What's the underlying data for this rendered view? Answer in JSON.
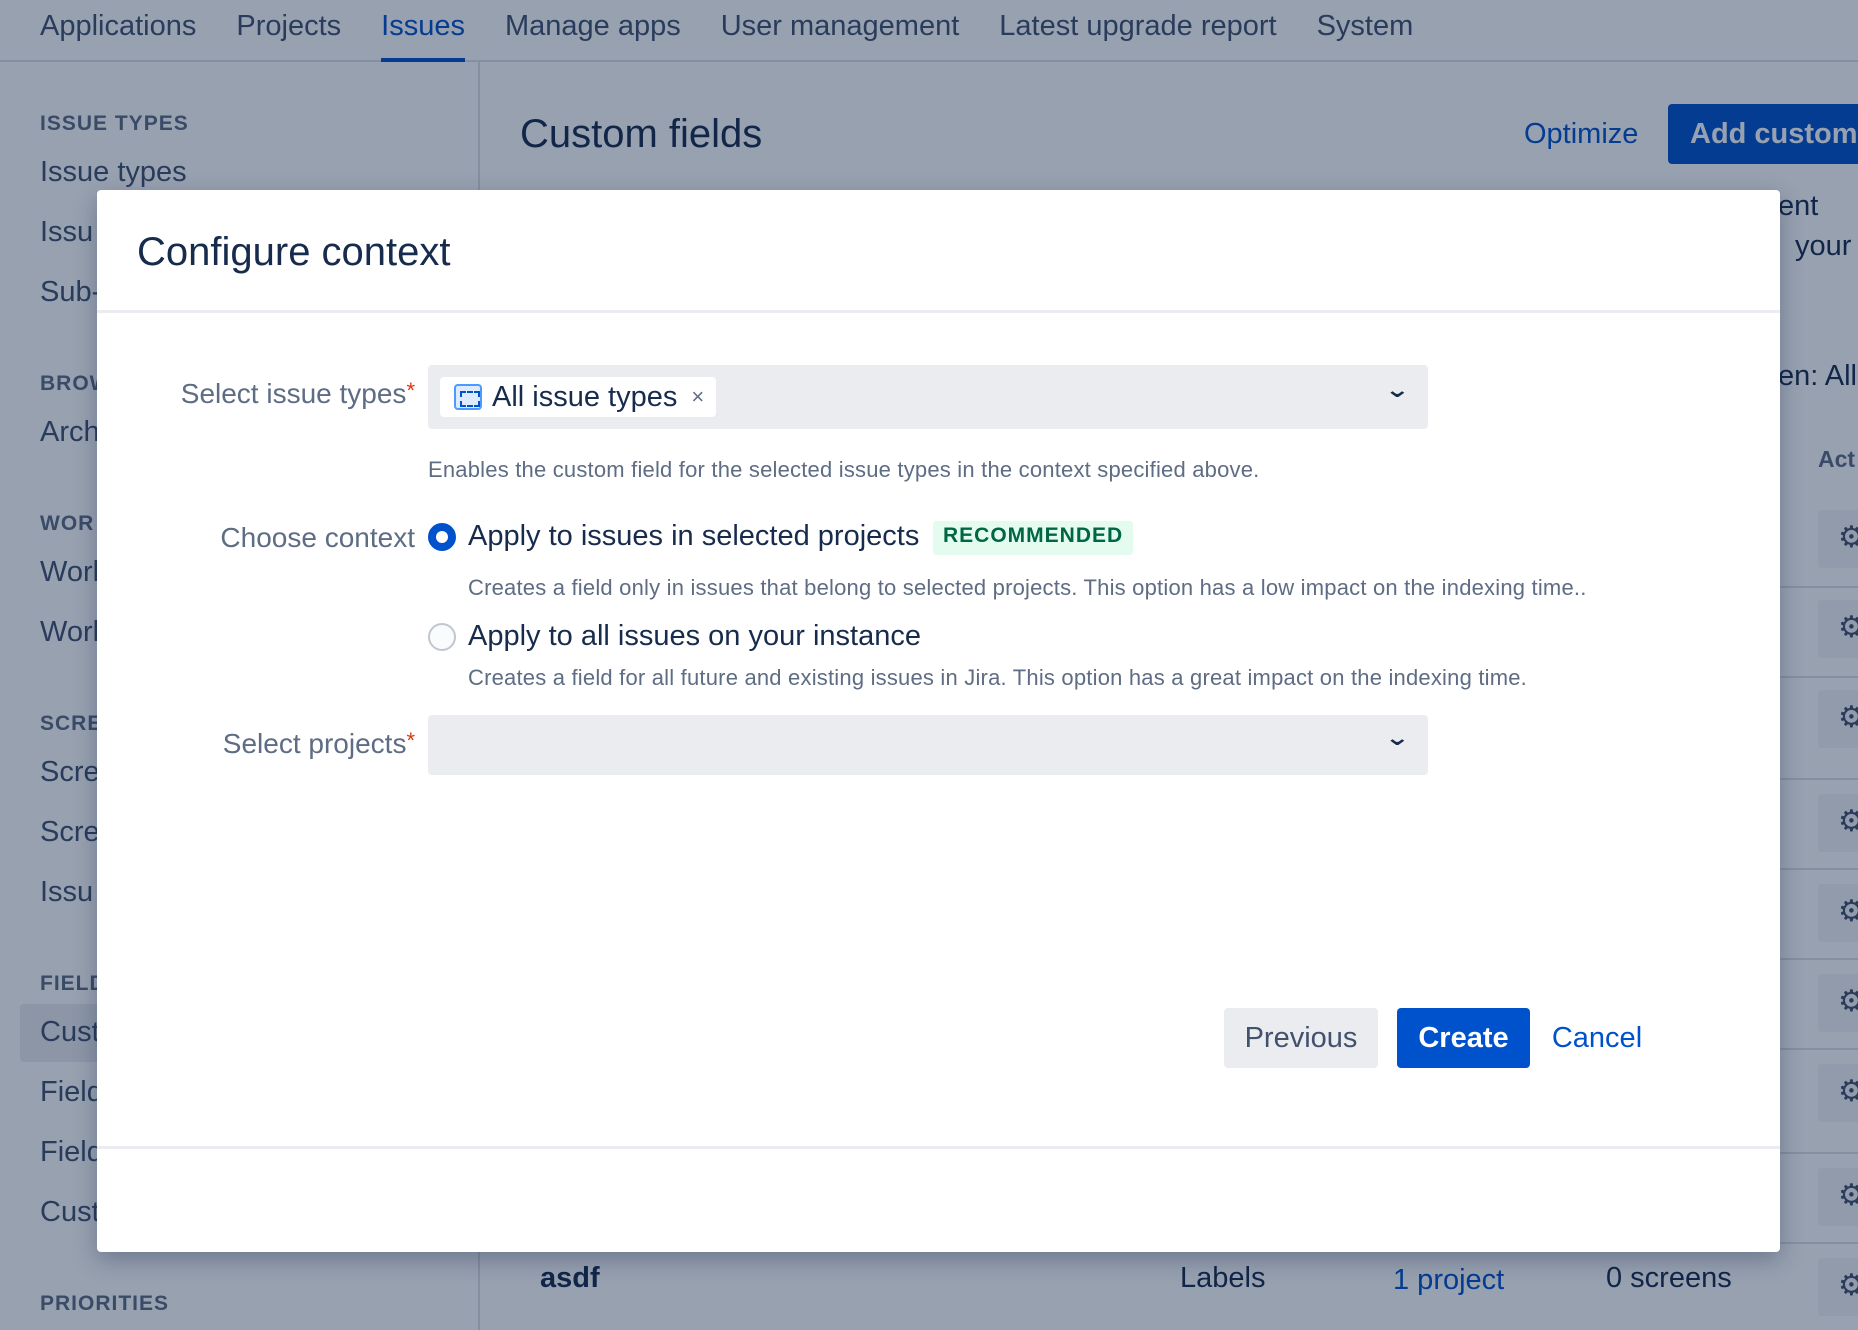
{
  "top_nav": {
    "tabs": [
      {
        "label": "Applications",
        "active": false
      },
      {
        "label": "Projects",
        "active": false
      },
      {
        "label": "Issues",
        "active": true
      },
      {
        "label": "Manage apps",
        "active": false
      },
      {
        "label": "User management",
        "active": false
      },
      {
        "label": "Latest upgrade report",
        "active": false
      },
      {
        "label": "System",
        "active": false
      }
    ]
  },
  "sidebar": {
    "sections": [
      {
        "heading": "ISSUE TYPES",
        "items": [
          "Issue types",
          "Issu",
          "Sub-"
        ]
      },
      {
        "heading": "BROW",
        "items": [
          "Arch"
        ]
      },
      {
        "heading": "WOR",
        "items": [
          "Worl",
          "Worl"
        ]
      },
      {
        "heading": "SCRE",
        "items": [
          "Scre",
          "Scre",
          "Issu"
        ]
      },
      {
        "heading": "FIELD",
        "items": [
          "Cust",
          "Field",
          "Field",
          "Cust"
        ]
      },
      {
        "heading": "PRIORITIES",
        "items": []
      }
    ]
  },
  "main": {
    "title": "Custom fields",
    "optimize_label": "Optimize",
    "add_custom_label": "Add custom",
    "partial_texts": [
      "ent",
      "your",
      "en: All",
      "Act"
    ],
    "visible_row": {
      "name": "asdf",
      "type": "Labels",
      "projects": "1 project",
      "screens": "0 screens"
    }
  },
  "modal": {
    "title": "Configure context",
    "issue_types": {
      "label": "Select issue types",
      "required_mark": "*",
      "selected_tag": "All issue types",
      "remove_glyph": "×",
      "chevron_glyph": "⌄",
      "help": "Enables the custom field for the selected issue types in the context specified above."
    },
    "context": {
      "label": "Choose context",
      "options": [
        {
          "label": "Apply to issues in selected projects",
          "badge": "RECOMMENDED",
          "description": "Creates a field only in issues that belong to selected projects. This option has a low impact on the indexing time..",
          "checked": true
        },
        {
          "label": "Apply to all issues on your instance",
          "description": "Creates a field for all future and existing issues in Jira. This option has a great impact on the indexing time.",
          "checked": false
        }
      ]
    },
    "projects": {
      "label": "Select projects",
      "required_mark": "*",
      "value": "",
      "chevron_glyph": "⌄"
    },
    "footer": {
      "previous_label": "Previous",
      "create_label": "Create",
      "cancel_label": "Cancel"
    }
  },
  "colors": {
    "primary": "#0052cc",
    "required": "#de350b",
    "lozenge_bg": "#e3fcef",
    "lozenge_text": "#006644",
    "overlay": "rgba(9, 30, 66, 0.42)"
  }
}
